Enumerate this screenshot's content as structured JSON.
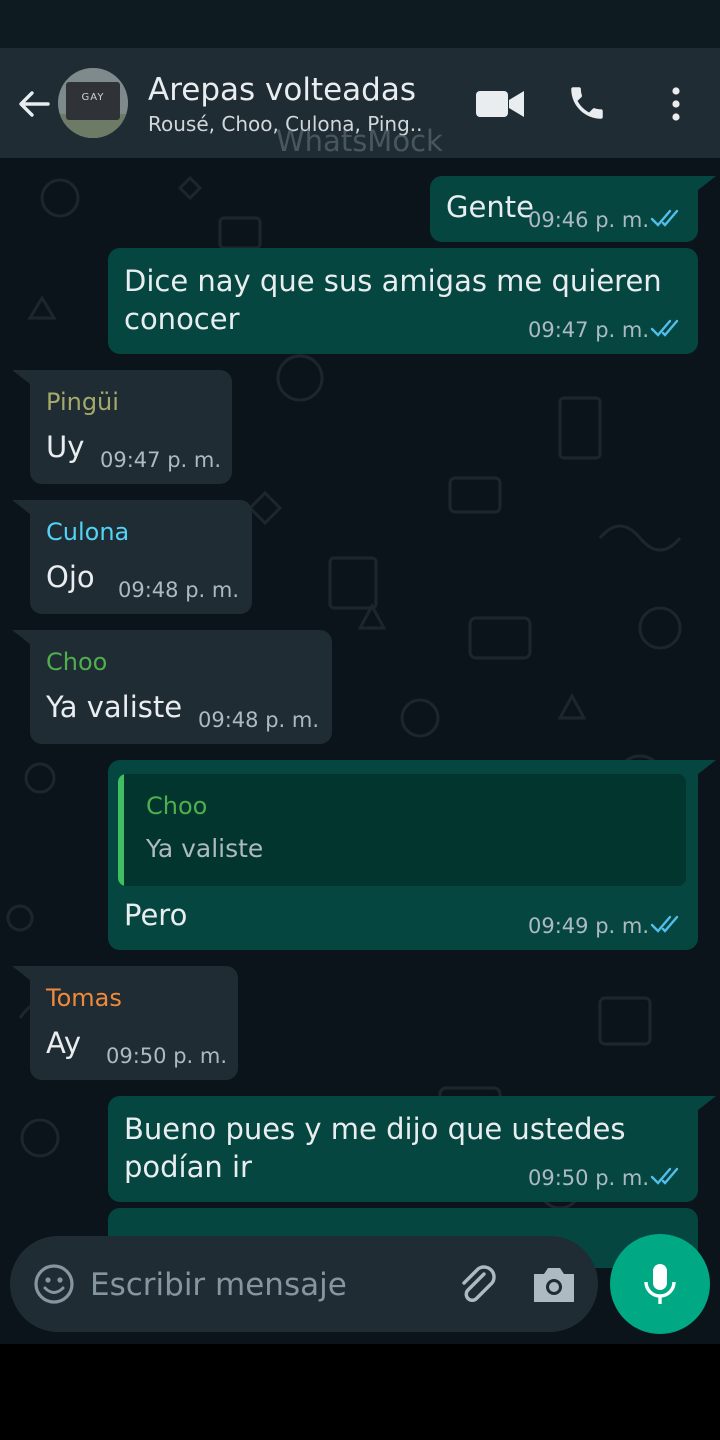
{
  "header": {
    "title": "Arepas volteadas",
    "subtitle": "Rousé, Choo, Culona, Ping..",
    "avatar_text": "GAY",
    "watermark": "WhatsMock"
  },
  "messages": [
    {
      "text": "Gente",
      "time": "09:46 p. m."
    },
    {
      "line1": "Dice nay que sus amigas me quieren",
      "line2": "conocer",
      "time": "09:47 p. m."
    },
    {
      "sender": "Pingüi",
      "text": "Uy",
      "time": "09:47 p. m."
    },
    {
      "sender": "Culona",
      "text": "Ojo",
      "time": "09:48 p. m."
    },
    {
      "sender": "Choo",
      "text": "Ya valiste",
      "time": "09:48 p. m."
    },
    {
      "quote_sender": "Choo",
      "quote_text": "Ya valiste",
      "text": "Pero",
      "time": "09:49 p. m."
    },
    {
      "sender": "Tomas",
      "text": "Ay",
      "time": "09:50 p. m."
    },
    {
      "line1": "Bueno pues y me dijo que ustedes",
      "line2": "podían ir",
      "time": "09:50 p. m."
    }
  ],
  "composer": {
    "placeholder": "Escribir mensaje"
  },
  "colors": {
    "header_bg": "#1f2c33",
    "chat_bg": "#0b141a",
    "outgoing_bubble": "#054740",
    "incoming_bubble": "#1f2c33",
    "accent": "#00a884",
    "read_ticks": "#53bdeb",
    "sender_pingui": "#a5a96a",
    "sender_culona": "#53d3f5",
    "sender_choo": "#4fae4e",
    "sender_tomas": "#f08a3a"
  },
  "icons": [
    "back-arrow-icon",
    "video-call-icon",
    "phone-icon",
    "more-vert-icon",
    "emoji-icon",
    "attach-icon",
    "camera-icon",
    "mic-icon",
    "double-check-icon"
  ]
}
